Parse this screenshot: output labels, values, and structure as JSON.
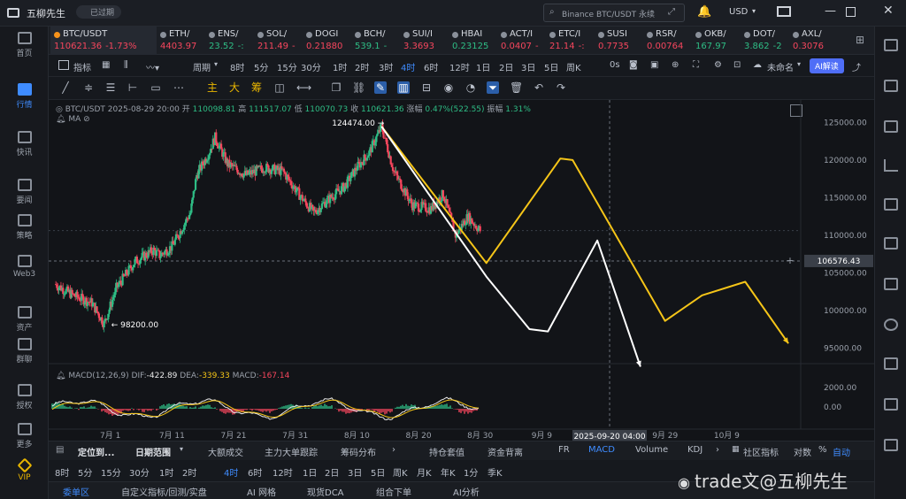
{
  "app": {
    "title": "五柳先生",
    "status_badge": "已过期",
    "search_placeholder": "Binance BTC/USDT 永续",
    "currency": "USD"
  },
  "nav": [
    {
      "label": "首页",
      "icon": "home-icon"
    },
    {
      "label": "行情",
      "icon": "market-icon",
      "active": true
    },
    {
      "label": "快讯",
      "icon": "news-icon"
    },
    {
      "label": "要闻",
      "icon": "headlines-icon"
    },
    {
      "label": "策略",
      "icon": "robot-icon"
    },
    {
      "label": "Web3",
      "icon": "web3-icon"
    },
    {
      "label": "资产",
      "icon": "wallet-icon"
    },
    {
      "label": "群聊",
      "icon": "chat-icon"
    },
    {
      "label": "授权",
      "icon": "key-icon"
    },
    {
      "label": "更多",
      "icon": "more-icon"
    },
    {
      "label": "VIP",
      "icon": "vip-icon"
    }
  ],
  "tickers": [
    {
      "name": "BTC/USDT",
      "price": "110621.36",
      "change": "-1.73%",
      "dir": "dn"
    },
    {
      "name": "ETH/",
      "price": "4403.97",
      "change": "",
      "dir": "dn"
    },
    {
      "name": "ENS/",
      "price": "23.52",
      "change": "-:",
      "dir": "up"
    },
    {
      "name": "SOL/",
      "price": "211.49",
      "change": "-",
      "dir": "dn"
    },
    {
      "name": "DOGI",
      "price": "0.21880",
      "change": "",
      "dir": "dn"
    },
    {
      "name": "BCH/",
      "price": "539.1",
      "change": "-",
      "dir": "up"
    },
    {
      "name": "SUI/I",
      "price": "3.3693",
      "change": "",
      "dir": "dn"
    },
    {
      "name": "HBAI",
      "price": "0.23125",
      "change": "",
      "dir": "up"
    },
    {
      "name": "ACT/I",
      "price": "0.0407",
      "change": "-",
      "dir": "dn"
    },
    {
      "name": "ETC/I",
      "price": "21.14",
      "change": "-:",
      "dir": "dn"
    },
    {
      "name": "SUSI",
      "price": "0.7735",
      "change": "",
      "dir": "dn"
    },
    {
      "name": "RSR/",
      "price": "0.00764",
      "change": "",
      "dir": "dn"
    },
    {
      "name": "OKB/",
      "price": "167.97",
      "change": "",
      "dir": "up"
    },
    {
      "name": "DOT/",
      "price": "3.862",
      "change": "-2",
      "dir": "up"
    },
    {
      "name": "AXL/",
      "price": "0.3076",
      "change": "",
      "dir": "dn"
    }
  ],
  "toolbar": {
    "indicators": "指标",
    "period": "周期",
    "intervals": [
      "8时",
      "5分",
      "15分",
      "30分",
      "1时",
      "2时",
      "3时",
      "4时",
      "6时",
      "12时",
      "1日",
      "2日",
      "3日",
      "5日",
      "周K"
    ],
    "selected_interval": "4时",
    "right_label": "0s",
    "unnamed": "未命名",
    "ai_label": "AI解读"
  },
  "drawtools": {
    "main": "主",
    "big": "大",
    "chip": "筹"
  },
  "legend": {
    "symbol": "BTC/USDT",
    "date": "2025-08-29 20:00",
    "open_label": "开",
    "open": "110098.81",
    "high_label": "高",
    "high": "111517.07",
    "low_label": "低",
    "low": "110070.73",
    "close_label": "收",
    "close": "110621.36",
    "change_label": "涨幅",
    "change": "0.47%(522.55)",
    "amp_label": "振幅",
    "amp": "1.31%",
    "ma": "MA"
  },
  "chart_data": {
    "type": "candlestick",
    "symbol": "BTC/USDT",
    "interval": "4时",
    "x_ticks": [
      "7月 1",
      "7月 11",
      "7月 21",
      "7月 31",
      "8月 10",
      "8月 20",
      "8月 30",
      "9月 9",
      "9月 29",
      "10月 9"
    ],
    "y_ticks": [
      125000.0,
      120000.0,
      115000.0,
      110000.0,
      105000.0,
      100000.0,
      95000.0
    ],
    "ylim": [
      93500,
      128000
    ],
    "crosshair_price": "106576.43",
    "crosshair_date": "2025-09-20 04:00",
    "annotations": [
      {
        "label": "124474.00",
        "price": 124474.0
      },
      {
        "label": "98200.00",
        "price": 98200.0
      }
    ],
    "price_path": [
      [
        "2025-06-22",
        103500
      ],
      [
        "2025-06-25",
        102000
      ],
      [
        "2025-06-28",
        101000
      ],
      [
        "2025-06-30",
        98200
      ],
      [
        "2025-07-02",
        103000
      ],
      [
        "2025-07-05",
        106500
      ],
      [
        "2025-07-08",
        108000
      ],
      [
        "2025-07-09",
        107300
      ],
      [
        "2025-07-11",
        108500
      ],
      [
        "2025-07-12",
        110000
      ],
      [
        "2025-07-14",
        113000
      ],
      [
        "2025-07-15",
        118000
      ],
      [
        "2025-07-17",
        121000
      ],
      [
        "2025-07-18",
        123000
      ],
      [
        "2025-07-20",
        119500
      ],
      [
        "2025-07-23",
        118000
      ],
      [
        "2025-07-26",
        119000
      ],
      [
        "2025-07-29",
        118500
      ],
      [
        "2025-08-01",
        115000
      ],
      [
        "2025-08-03",
        113000
      ],
      [
        "2025-08-05",
        114500
      ],
      [
        "2025-08-08",
        116500
      ],
      [
        "2025-08-10",
        119000
      ],
      [
        "2025-08-12",
        121000
      ],
      [
        "2025-08-14",
        124474
      ],
      [
        "2025-08-16",
        118500
      ],
      [
        "2025-08-19",
        114000
      ],
      [
        "2025-08-22",
        113500
      ],
      [
        "2025-08-24",
        115500
      ],
      [
        "2025-08-26",
        110000
      ],
      [
        "2025-08-28",
        112500
      ],
      [
        "2025-08-30",
        110621
      ]
    ],
    "projections": [
      {
        "color": "#f5c518",
        "points": [
          [
            "2025-08-14",
            124474
          ],
          [
            "2025-08-31",
            106300
          ],
          [
            "2025-09-12",
            120200
          ],
          [
            "2025-09-14",
            120000
          ],
          [
            "2025-09-29",
            98600
          ],
          [
            "2025-10-05",
            102000
          ],
          [
            "2025-10-12",
            103800
          ],
          [
            "2025-10-19",
            95600
          ]
        ]
      },
      {
        "color": "#ffffff",
        "points": [
          [
            "2025-08-14",
            124474
          ],
          [
            "2025-08-31",
            104500
          ],
          [
            "2025-09-07",
            97500
          ],
          [
            "2025-09-10",
            97200
          ],
          [
            "2025-09-18",
            109300
          ],
          [
            "2025-09-25",
            92500
          ]
        ]
      }
    ],
    "macd": {
      "label": "MACD(12,26,9)",
      "dif_label": "DIF",
      "dif": "-422.89",
      "dea_label": "DEA",
      "dea": "-339.33",
      "macd_label": "MACD",
      "macd": "-167.14",
      "y_ticks": [
        2000.0,
        0.0
      ]
    }
  },
  "bottom1": {
    "locate": "定位到...",
    "range": "日期范围",
    "tabs": [
      "大额成交",
      "主力大单跟踪",
      "筹码分布",
      "持仓套值",
      "资金背离",
      "FR",
      "MACD",
      "Volume",
      "KDJ"
    ],
    "selected_tab": "MACD",
    "right": [
      "社区指标",
      "对数",
      "%",
      "自动"
    ]
  },
  "bottom2": {
    "intervals": [
      "8时",
      "5分",
      "15分",
      "30分",
      "1时",
      "2时",
      "4时",
      "6时",
      "12时",
      "1日",
      "2日",
      "3日",
      "5日",
      "周K",
      "月K",
      "年K",
      "1分",
      "季K"
    ],
    "selected": "4时"
  },
  "bottom3": {
    "tabs": [
      "委单区",
      "自定义指标/回测/实盘",
      "AI 网格",
      "现货DCA",
      "组合下单",
      "AI分析"
    ]
  },
  "watermark": "trade文@五柳先生",
  "colors": {
    "up": "#2ebd85",
    "down": "#f6465d",
    "accent": "#3f8cff",
    "yellow": "#f5c518"
  }
}
